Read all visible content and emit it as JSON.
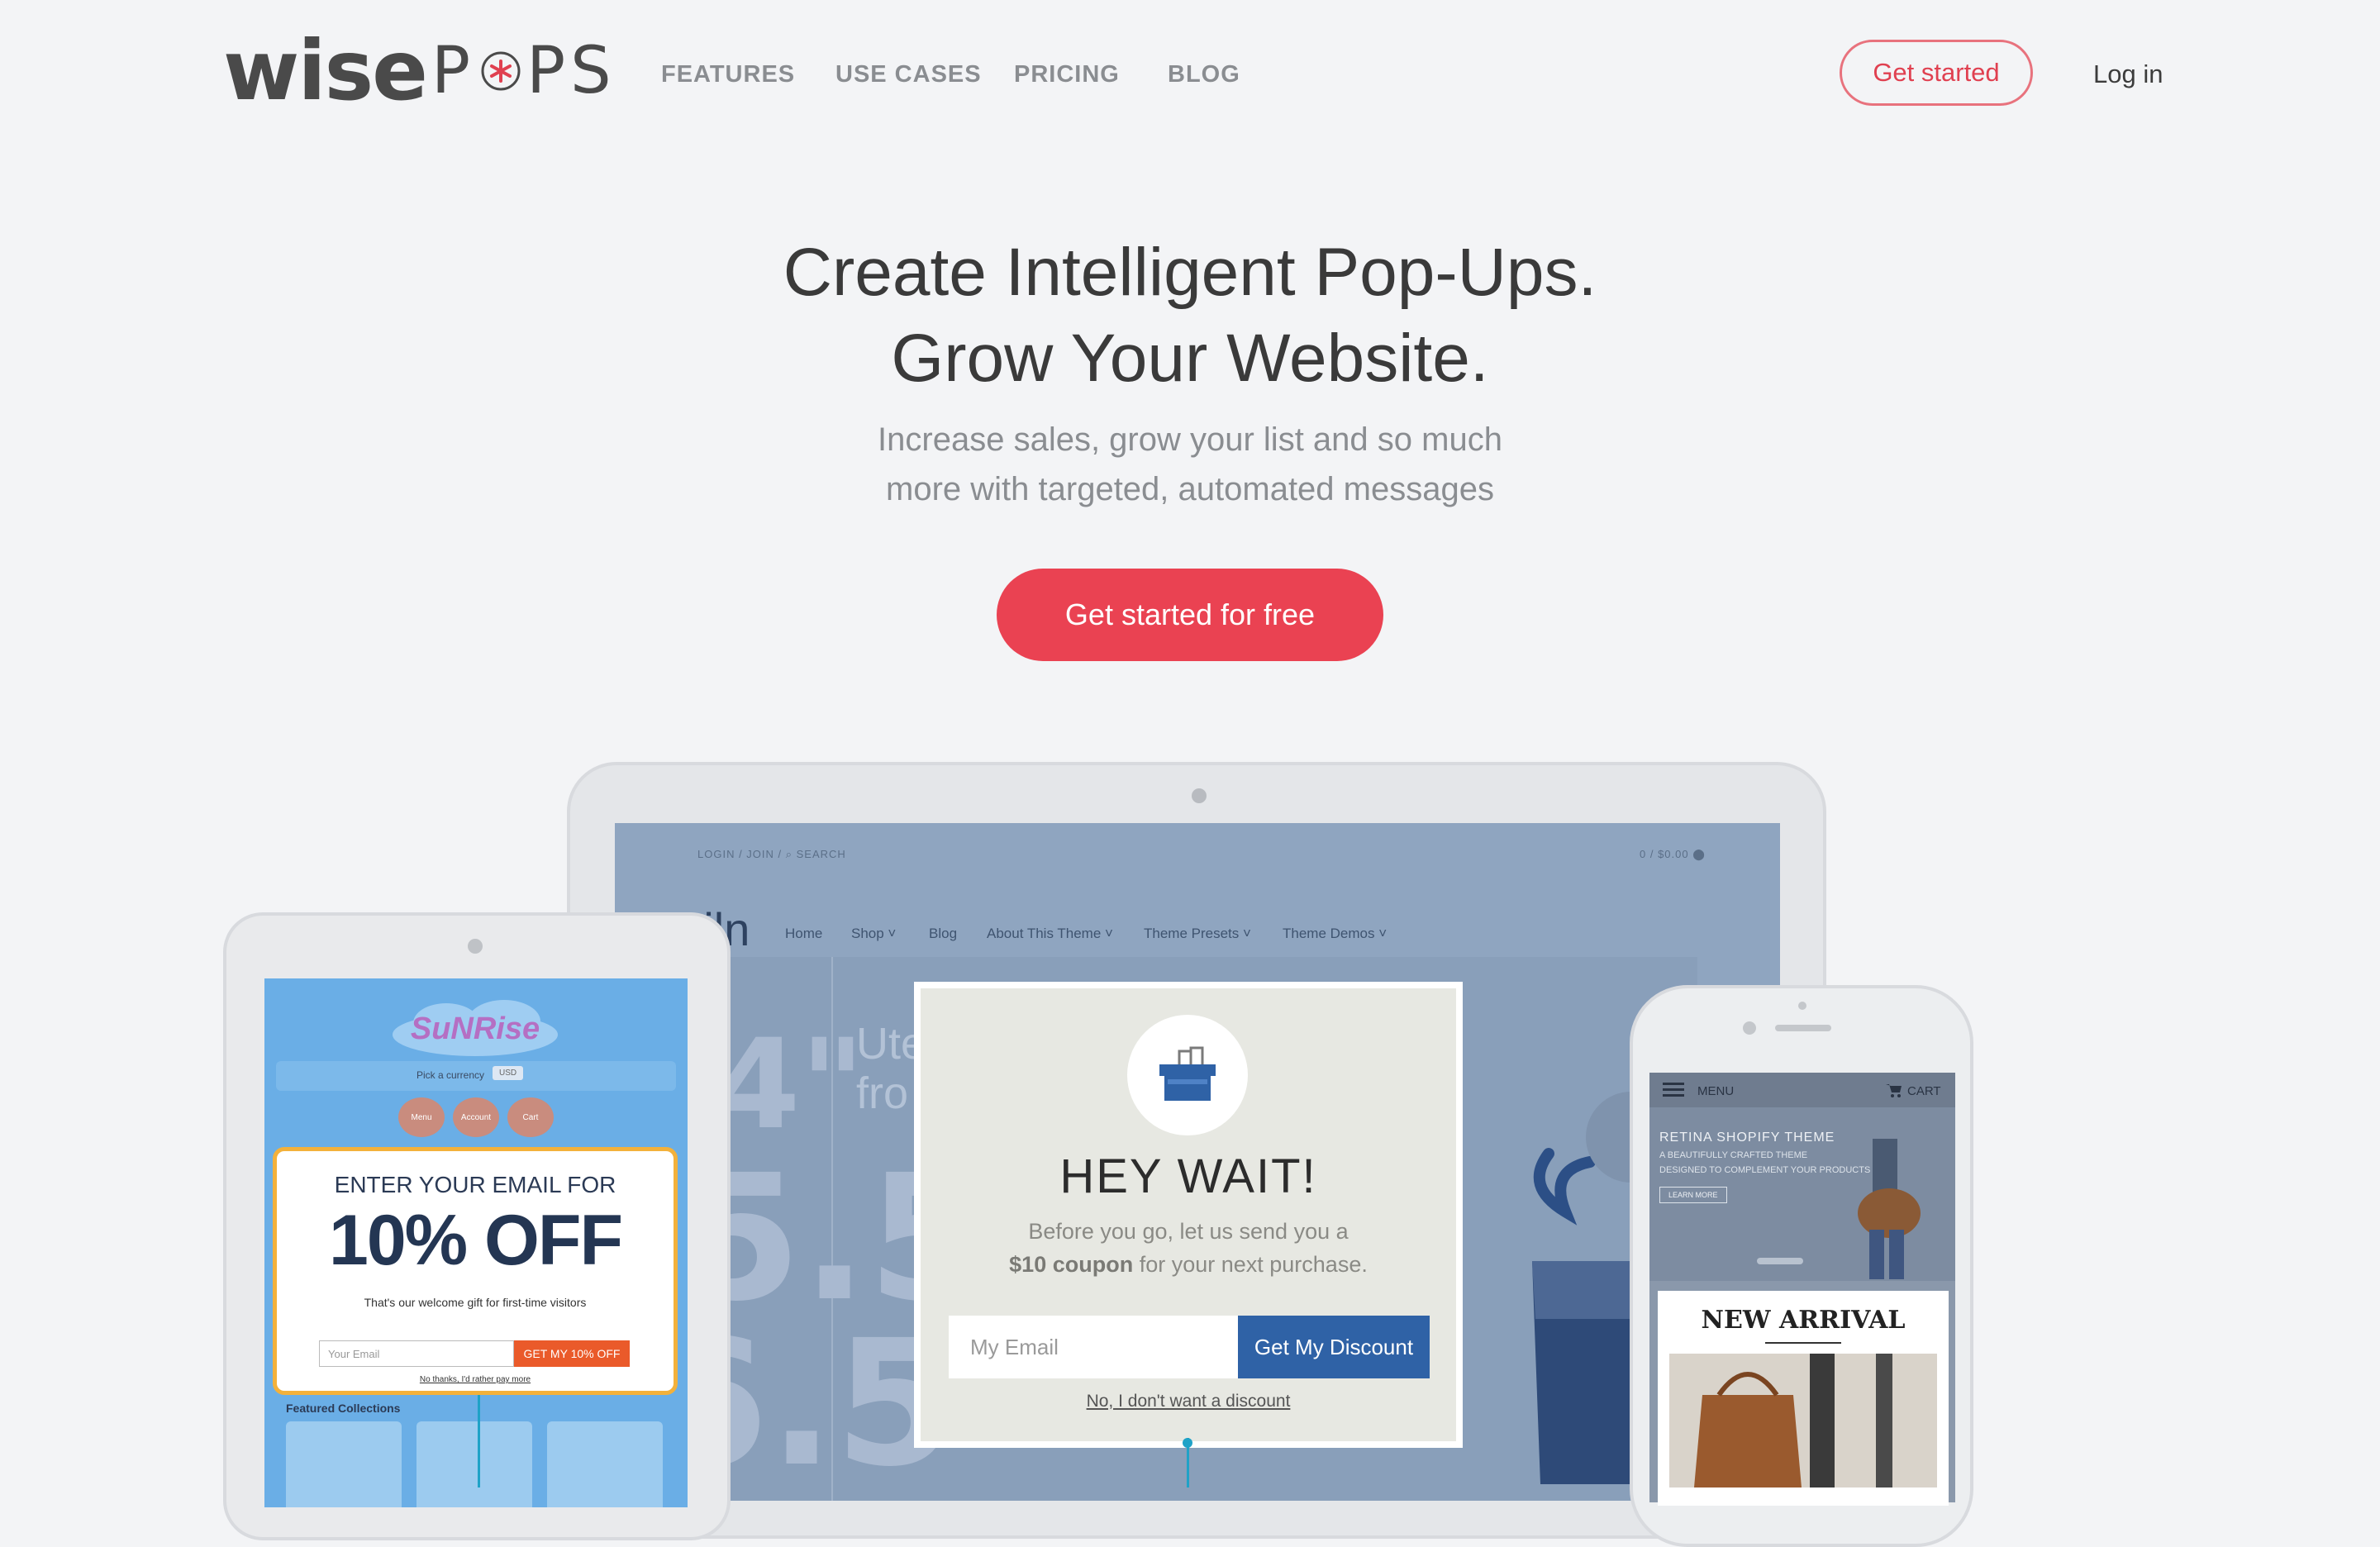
{
  "header": {
    "logo_left": "wise",
    "logo_right_1": "P",
    "logo_right_2": "PS",
    "nav": [
      "FEATURES",
      "USE CASES",
      "PRICING",
      "BLOG"
    ],
    "get_started": "Get started",
    "login": "Log in"
  },
  "hero": {
    "title_line1": "Create Intelligent Pop-Ups.",
    "title_line2": "Grow Your Website.",
    "subtitle_line1": "Increase sales, grow your list and so much",
    "subtitle_line2": "more with targeted, automated messages",
    "cta": "Get started for free"
  },
  "laptop_site": {
    "top_left": "LOGIN / JOIN / ⌕ SEARCH",
    "top_right": "0 / $0.00 ⬤",
    "brand": "Kiln",
    "nav": [
      "Home",
      "Shop ˅",
      "Blog",
      "About This Theme ˅",
      "Theme Presets ˅",
      "Theme Demos ˅"
    ],
    "bg_text_1": "Ute",
    "bg_text_2": "fro"
  },
  "popup": {
    "title": "HEY WAIT!",
    "text_line1": "Before you go, let us send you a",
    "text_bold": "$10 coupon",
    "text_line2_rest": " for your next purchase.",
    "email_placeholder": "My Email",
    "button": "Get My Discount",
    "decline": "No, I don't want a discount"
  },
  "tablet_site": {
    "logo": "SuNRise",
    "currency_label": "Pick a currency",
    "currency_value": "USD",
    "pills": [
      "Menu",
      "Account",
      "Cart"
    ],
    "popup_line1": "ENTER YOUR EMAIL FOR",
    "popup_line2": "10% OFF",
    "popup_line3": "That's our welcome gift for first-time visitors",
    "email_placeholder": "Your Email",
    "button": "GET MY 10% OFF",
    "decline": "No thanks, I'd rather pay more",
    "featured": "Featured Collections"
  },
  "phone_site": {
    "menu": "MENU",
    "cart": "CART",
    "hero_title": "RETINA SHOPIFY THEME",
    "hero_sub_1": "A BEAUTIFULLY CRAFTED THEME",
    "hero_sub_2": "DESIGNED TO COMPLEMENT YOUR PRODUCTS",
    "learn_more": "LEARN MORE",
    "new_arrival": "NEW ARRIVAL"
  },
  "colors": {
    "background": "#f3f4f6",
    "accent": "#ea4252",
    "popup_button": "#2f62a6",
    "tablet_popup_border": "#f3b13b"
  }
}
